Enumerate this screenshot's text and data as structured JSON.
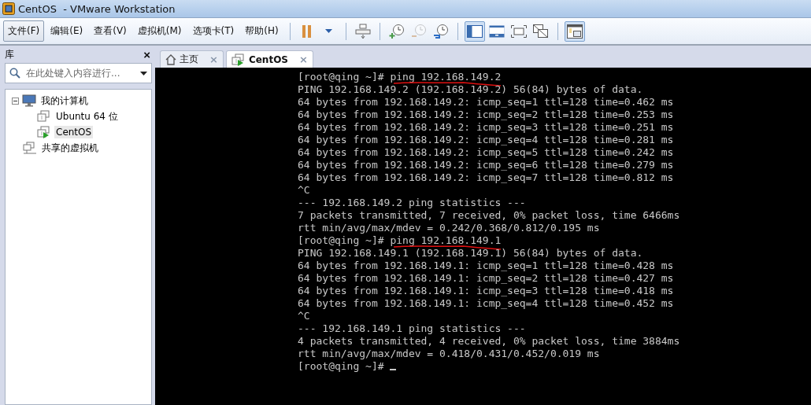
{
  "window": {
    "title": "CentOS  - VMware Workstation"
  },
  "menu": [
    {
      "label": "文件(F)",
      "selected": true
    },
    {
      "label": "编辑(E)",
      "selected": false
    },
    {
      "label": "查看(V)",
      "selected": false
    },
    {
      "label": "虚拟机(M)",
      "selected": false
    },
    {
      "label": "选项卡(T)",
      "selected": false
    },
    {
      "label": "帮助(H)",
      "selected": false
    }
  ],
  "toolbar": [
    {
      "kind": "pause",
      "selected": false,
      "disabled": false
    },
    {
      "kind": "caret",
      "selected": false,
      "disabled": false
    },
    {
      "kind": "sep"
    },
    {
      "kind": "send-keys",
      "selected": false,
      "disabled": false
    },
    {
      "kind": "sep"
    },
    {
      "kind": "snapshot-take",
      "selected": false,
      "disabled": false
    },
    {
      "kind": "snapshot-revert",
      "selected": false,
      "disabled": true
    },
    {
      "kind": "snapshot-manager",
      "selected": false,
      "disabled": false
    },
    {
      "kind": "sep"
    },
    {
      "kind": "console-view",
      "selected": true,
      "disabled": false
    },
    {
      "kind": "fit-guest",
      "selected": false,
      "disabled": false
    },
    {
      "kind": "full-screen",
      "selected": false,
      "disabled": false
    },
    {
      "kind": "unity",
      "selected": false,
      "disabled": false
    },
    {
      "kind": "sep"
    },
    {
      "kind": "thumbnail",
      "selected": true,
      "disabled": false
    }
  ],
  "library": {
    "title": "库",
    "close": "×",
    "search": {
      "placeholder": "在此处键入内容进行..."
    },
    "tree": [
      {
        "label": "我的计算机",
        "kind": "computer",
        "expanded": true,
        "selected": false,
        "children": [
          {
            "label": "Ubuntu 64 位",
            "kind": "vm",
            "running": false,
            "selected": false
          },
          {
            "label": "CentOS",
            "kind": "vm",
            "running": true,
            "selected": true
          }
        ]
      },
      {
        "label": "共享的虚拟机",
        "kind": "shared",
        "selected": false
      }
    ]
  },
  "tabs": [
    {
      "label": "主页",
      "kind": "home",
      "selected": false,
      "close": "×"
    },
    {
      "label": "CentOS",
      "kind": "vm",
      "selected": true,
      "close": "×"
    }
  ],
  "terminal": {
    "lines": [
      {
        "text": "[root@qing ~]# ping 192.168.149.2",
        "marked": true
      },
      {
        "text": "PING 192.168.149.2 (192.168.149.2) 56(84) bytes of data."
      },
      {
        "text": "64 bytes from 192.168.149.2: icmp_seq=1 ttl=128 time=0.462 ms"
      },
      {
        "text": "64 bytes from 192.168.149.2: icmp_seq=2 ttl=128 time=0.253 ms"
      },
      {
        "text": "64 bytes from 192.168.149.2: icmp_seq=3 ttl=128 time=0.251 ms"
      },
      {
        "text": "64 bytes from 192.168.149.2: icmp_seq=4 ttl=128 time=0.281 ms"
      },
      {
        "text": "64 bytes from 192.168.149.2: icmp_seq=5 ttl=128 time=0.242 ms"
      },
      {
        "text": "64 bytes from 192.168.149.2: icmp_seq=6 ttl=128 time=0.279 ms"
      },
      {
        "text": "64 bytes from 192.168.149.2: icmp_seq=7 ttl=128 time=0.812 ms"
      },
      {
        "text": "^C"
      },
      {
        "text": "--- 192.168.149.2 ping statistics ---"
      },
      {
        "text": "7 packets transmitted, 7 received, 0% packet loss, time 6466ms"
      },
      {
        "text": "rtt min/avg/max/mdev = 0.242/0.368/0.812/0.195 ms"
      },
      {
        "text": "[root@qing ~]# ping 192.168.149.1",
        "marked": true
      },
      {
        "text": "PING 192.168.149.1 (192.168.149.1) 56(84) bytes of data."
      },
      {
        "text": "64 bytes from 192.168.149.1: icmp_seq=1 ttl=128 time=0.428 ms"
      },
      {
        "text": "64 bytes from 192.168.149.1: icmp_seq=2 ttl=128 time=0.427 ms"
      },
      {
        "text": "64 bytes from 192.168.149.1: icmp_seq=3 ttl=128 time=0.418 ms"
      },
      {
        "text": "64 bytes from 192.168.149.1: icmp_seq=4 ttl=128 time=0.452 ms"
      },
      {
        "text": "^C"
      },
      {
        "text": "--- 192.168.149.1 ping statistics ---"
      },
      {
        "text": "4 packets transmitted, 4 received, 0% packet loss, time 3884ms"
      },
      {
        "text": "rtt min/avg/max/mdev = 0.418/0.431/0.452/0.019 ms"
      },
      {
        "text": "[root@qing ~]# ",
        "cursor": true
      }
    ]
  }
}
